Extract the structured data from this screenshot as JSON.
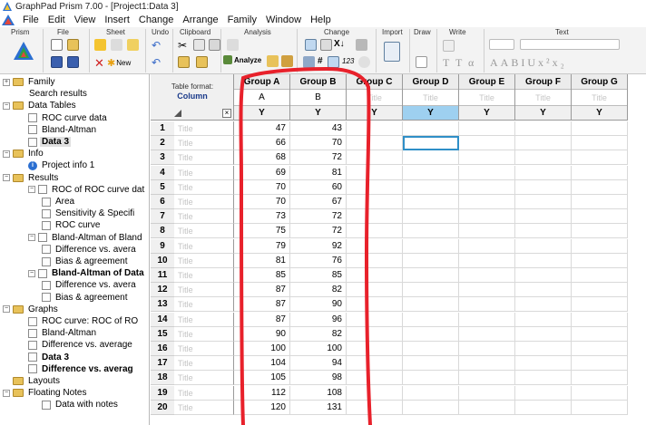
{
  "window": {
    "title": "GraphPad Prism 7.00 - [Project1:Data 3]"
  },
  "menu": [
    "File",
    "Edit",
    "View",
    "Insert",
    "Change",
    "Arrange",
    "Family",
    "Window",
    "Help"
  ],
  "ribbon": {
    "groups": [
      "Prism",
      "File",
      "Sheet",
      "Undo",
      "Clipboard",
      "Analysis",
      "Change",
      "Import",
      "Draw",
      "Write",
      "Text"
    ],
    "new_label": "New",
    "analyze_label": "Analyze",
    "change_number": "123"
  },
  "navigator": {
    "items": [
      {
        "label": "Family",
        "kind": "folder",
        "expander": "+"
      },
      {
        "label": "Search results",
        "kind": "plain"
      },
      {
        "label": "Data Tables",
        "kind": "folder",
        "expander": "−"
      },
      {
        "label": "ROC curve data",
        "kind": "table"
      },
      {
        "label": "Bland-Altman",
        "kind": "table"
      },
      {
        "label": "Data 3",
        "kind": "table",
        "bold": true,
        "selected": true
      },
      {
        "label": "Info",
        "kind": "folder",
        "expander": "−"
      },
      {
        "label": "Project info 1",
        "kind": "info"
      },
      {
        "label": "Results",
        "kind": "folder",
        "expander": "−"
      },
      {
        "label": "ROC of ROC curve dat",
        "kind": "result",
        "expander": "−"
      },
      {
        "label": "Area",
        "kind": "sheet"
      },
      {
        "label": "Sensitivity & Specifi",
        "kind": "sheet"
      },
      {
        "label": "ROC curve",
        "kind": "sheet"
      },
      {
        "label": "Bland-Altman of Bland",
        "kind": "result",
        "expander": "−"
      },
      {
        "label": "Difference vs. avera",
        "kind": "sheet"
      },
      {
        "label": "Bias & agreement",
        "kind": "sheet"
      },
      {
        "label": "Bland-Altman of Data",
        "kind": "result",
        "expander": "−",
        "bold": true
      },
      {
        "label": "Difference vs. avera",
        "kind": "sheet"
      },
      {
        "label": "Bias & agreement",
        "kind": "sheet"
      },
      {
        "label": "Graphs",
        "kind": "folder",
        "expander": "−"
      },
      {
        "label": "ROC curve: ROC of RO",
        "kind": "graph"
      },
      {
        "label": "Bland-Altman",
        "kind": "graph"
      },
      {
        "label": "Difference vs. average",
        "kind": "graph"
      },
      {
        "label": "Data 3",
        "kind": "graph",
        "bold": true
      },
      {
        "label": "Difference vs. averag",
        "kind": "graph",
        "bold": true
      },
      {
        "label": "Layouts",
        "kind": "folder"
      },
      {
        "label": "Floating Notes",
        "kind": "folder",
        "expander": "−"
      },
      {
        "label": "Data with notes",
        "kind": "sheet"
      }
    ]
  },
  "sheet": {
    "table_format_label": "Table format:",
    "table_format_value": "Column",
    "corner_x": "×",
    "title_placeholder": "Title",
    "columns": [
      {
        "name": "Group A",
        "sub": "A",
        "type": "Y"
      },
      {
        "name": "Group B",
        "sub": "B",
        "type": "Y"
      },
      {
        "name": "Group C",
        "sub": "Title",
        "type": "Y"
      },
      {
        "name": "Group D",
        "sub": "Title",
        "type": "Y",
        "active": true
      },
      {
        "name": "Group E",
        "sub": "Title",
        "type": "Y"
      },
      {
        "name": "Group F",
        "sub": "Title",
        "type": "Y"
      },
      {
        "name": "Group G",
        "sub": "Title",
        "type": "Y"
      }
    ],
    "rows": [
      {
        "n": "1",
        "a": "47",
        "b": "43"
      },
      {
        "n": "2",
        "a": "66",
        "b": "70"
      },
      {
        "n": "3",
        "a": "68",
        "b": "72"
      },
      {
        "n": "4",
        "a": "69",
        "b": "81"
      },
      {
        "n": "5",
        "a": "70",
        "b": "60"
      },
      {
        "n": "6",
        "a": "70",
        "b": "67"
      },
      {
        "n": "7",
        "a": "73",
        "b": "72"
      },
      {
        "n": "8",
        "a": "75",
        "b": "72"
      },
      {
        "n": "9",
        "a": "79",
        "b": "92"
      },
      {
        "n": "10",
        "a": "81",
        "b": "76"
      },
      {
        "n": "11",
        "a": "85",
        "b": "85"
      },
      {
        "n": "12",
        "a": "87",
        "b": "82"
      },
      {
        "n": "13",
        "a": "87",
        "b": "90"
      },
      {
        "n": "14",
        "a": "87",
        "b": "96"
      },
      {
        "n": "15",
        "a": "90",
        "b": "82"
      },
      {
        "n": "16",
        "a": "100",
        "b": "100"
      },
      {
        "n": "17",
        "a": "104",
        "b": "94"
      },
      {
        "n": "18",
        "a": "105",
        "b": "98"
      },
      {
        "n": "19",
        "a": "112",
        "b": "108"
      },
      {
        "n": "20",
        "a": "120",
        "b": "131"
      }
    ],
    "selected_cell": {
      "row": 2,
      "column": "Group D"
    }
  },
  "colors": {
    "annotation": "#e8212b",
    "active_column": "#9ed0f0",
    "selection": "#2f8fc7"
  }
}
